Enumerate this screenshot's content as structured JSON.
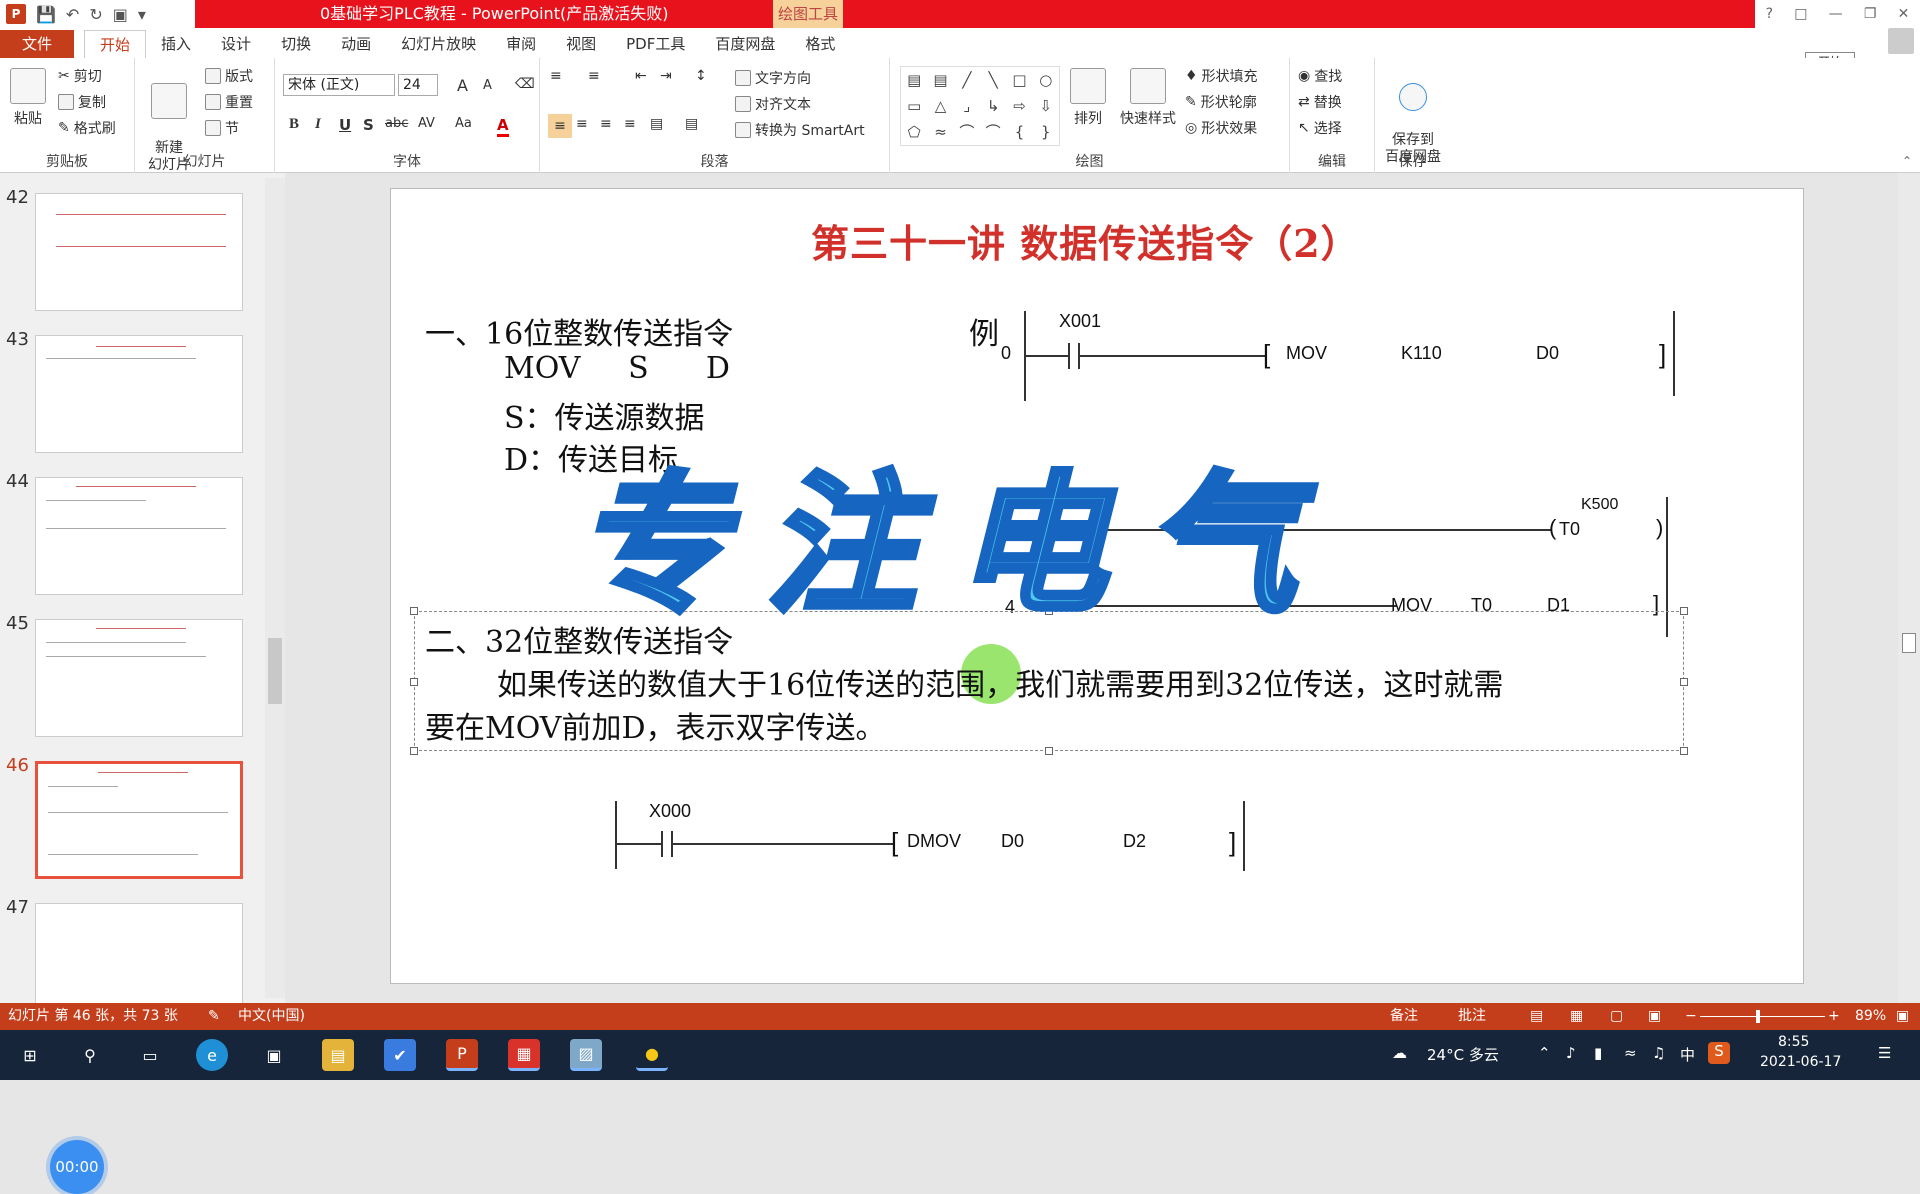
{
  "titlebar": {
    "doc_title": "0基础学习PLC教程 - PowerPoint(产品激活失败)",
    "drawing_tools": "绘图工具",
    "signin": "开始"
  },
  "tabs": [
    "文件",
    "开始",
    "插入",
    "设计",
    "切换",
    "动画",
    "幻灯片放映",
    "审阅",
    "视图",
    "PDF工具",
    "百度网盘",
    "格式"
  ],
  "ribbon": {
    "clipboard": {
      "paste": "粘贴",
      "cut": "剪切",
      "copy": "复制",
      "format_painter": "格式刷",
      "group": "剪贴板"
    },
    "slides": {
      "new_slide": "新建\n幻灯片",
      "layout": "版式",
      "reset": "重置",
      "section": "节",
      "group": "幻灯片"
    },
    "font": {
      "font_name": "宋体 (正文)",
      "font_size": "24",
      "group": "字体",
      "bold": "B",
      "italic": "I",
      "underline": "U",
      "strike": "abc",
      "shadow": "S",
      "spacing": "AV",
      "case": "Aa",
      "color": "A",
      "grow": "A",
      "shrink": "A"
    },
    "paragraph": {
      "text_direction": "文字方向",
      "align_text": "对齐文本",
      "smartart": "转换为 SmartArt",
      "group": "段落"
    },
    "drawing": {
      "arrange": "排列",
      "quick_styles": "快速样式",
      "shape_fill": "形状填充",
      "shape_outline": "形状轮廓",
      "shape_effects": "形状效果",
      "group": "绘图"
    },
    "editing": {
      "find": "查找",
      "replace": "替换",
      "select": "选择",
      "group": "编辑"
    },
    "save": {
      "save_baidu": "保存到\n百度网盘",
      "group": "保存"
    }
  },
  "slide_thumbs": [
    {
      "num": "42"
    },
    {
      "num": "43"
    },
    {
      "num": "44"
    },
    {
      "num": "45"
    },
    {
      "num": "46",
      "selected": true
    },
    {
      "num": "47"
    }
  ],
  "timer": "00:00",
  "slide": {
    "title": "第三十一讲  数据传送指令（2）",
    "sec1_heading": "一、16位整数传送指令",
    "sec1_line1": "MOV     S      D",
    "sec1_line2": "S：传送源数据",
    "sec1_line3": "D：传送目标",
    "example_label": "例",
    "rung1": {
      "step": "0",
      "contact": "X001",
      "instr": "MOV",
      "op1": "K110",
      "op2": "D0"
    },
    "rung2": {
      "k": "K500",
      "coil": "T0"
    },
    "rung3": {
      "instr": "MOV",
      "op1": "T0",
      "op2": "D1",
      "step": "4"
    },
    "sec2_heading": "二、32位整数传送指令",
    "sec2_body1": "如果传送的数值大于16位传送的范围，我们就需要用到32位传送，这时就需",
    "sec2_body2": "要在MOV前加D，表示双字传送。",
    "rung4": {
      "contact": "X000",
      "instr": "DMOV",
      "op1": "D0",
      "op2": "D2"
    },
    "watermark": "专注电气"
  },
  "statusbar": {
    "slide_info": "幻灯片 第 46 张，共 73 张",
    "language": "中文(中国)",
    "notes": "备注",
    "comments": "批注",
    "zoom": "89%"
  },
  "taskbar": {
    "weather": "24°C  多云",
    "time": "8:55",
    "date": "2021-06-17",
    "ime": "中"
  }
}
